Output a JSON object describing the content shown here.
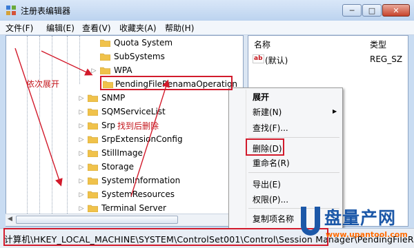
{
  "window": {
    "title": "注册表编辑器"
  },
  "menubar": [
    "文件(F)",
    "编辑(E)",
    "查看(V)",
    "收藏夹(A)",
    "帮助(H)"
  ],
  "tree": {
    "items": [
      {
        "label": "Quota System",
        "expandable": false,
        "level": 2
      },
      {
        "label": "SubSystems",
        "expandable": false,
        "level": 2
      },
      {
        "label": "WPA",
        "expandable": true,
        "level": 2
      },
      {
        "label": "PendingFileRenamaOperation",
        "expandable": false,
        "level": 2,
        "selected": true
      },
      {
        "label": "SNMP",
        "expandable": true,
        "level": 1
      },
      {
        "label": "SQMServiceList",
        "expandable": true,
        "level": 1
      },
      {
        "label": "Srp",
        "expandable": true,
        "level": 1
      },
      {
        "label": "SrpExtensionConfig",
        "expandable": true,
        "level": 1
      },
      {
        "label": "StillImage",
        "expandable": true,
        "level": 1
      },
      {
        "label": "Storage",
        "expandable": true,
        "level": 1
      },
      {
        "label": "SystemInformation",
        "expandable": true,
        "level": 1
      },
      {
        "label": "SystemResources",
        "expandable": true,
        "level": 1
      },
      {
        "label": "Terminal Server",
        "expandable": true,
        "level": 1
      }
    ]
  },
  "list": {
    "headers": {
      "name": "名称",
      "type": "类型"
    },
    "rows": [
      {
        "icon": "ab",
        "name": "(默认)",
        "type": "REG_SZ"
      }
    ]
  },
  "context_menu": {
    "items": [
      {
        "label": "展开",
        "bold": true
      },
      {
        "label": "新建(N)",
        "submenu": true
      },
      {
        "label": "查找(F)..."
      },
      {
        "label": "删除(D)",
        "highlighted": true
      },
      {
        "label": "重命名(R)"
      },
      {
        "label": "导出(E)"
      },
      {
        "label": "权限(P)..."
      },
      {
        "label": "复制项名称"
      }
    ]
  },
  "statusbar": {
    "path": "计算机\\HKEY_LOCAL_MACHINE\\SYSTEM\\ControlSet001\\Control\\Session Manager\\PendingFileRen"
  },
  "annotations": {
    "expand_note": "依次展开",
    "delete_note": "找到后删除"
  },
  "watermark": {
    "text": "盘量产网",
    "sub": "www.upantool.com"
  },
  "colors": {
    "annotation": "#d21a2b",
    "selection": "#3399ff",
    "brand_blue": "#1c58a8"
  }
}
